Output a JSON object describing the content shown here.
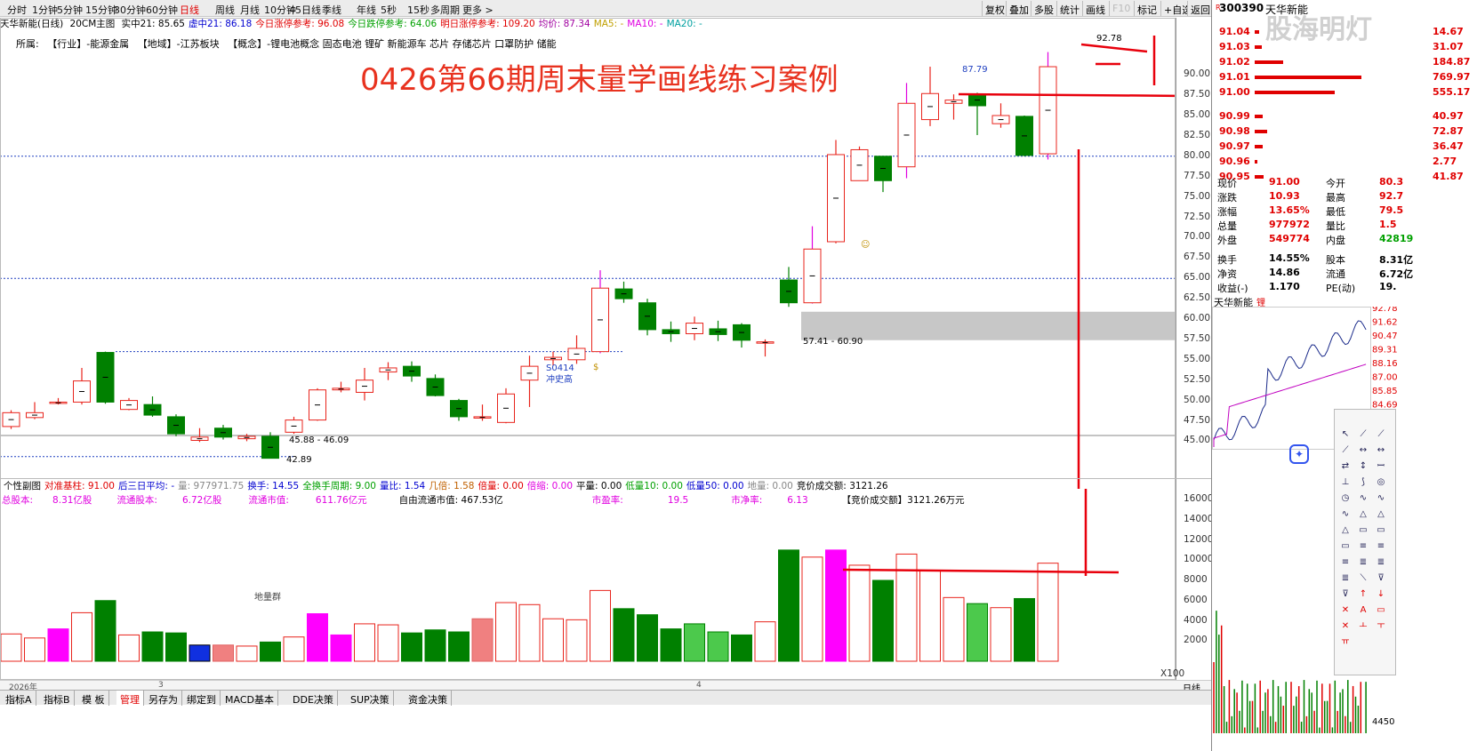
{
  "topbar": {
    "periods": [
      "分时",
      "1分钟",
      "5分钟",
      "15分钟",
      "30分钟",
      "60分钟",
      "日线",
      "周线",
      "月线",
      "10分钟",
      "45日线",
      "季线",
      "年线",
      "5秒",
      "15秒",
      "多周期",
      "更多"
    ],
    "selected_index": 6,
    "buttons": [
      "复权",
      "叠加",
      "多股",
      "统计",
      "画线",
      "F10",
      "标记",
      "+自选",
      "返回"
    ]
  },
  "title_row": {
    "name": "天华新能(日线)",
    "indicator": "20CM主图",
    "items": [
      {
        "t": "实中21: 85.65",
        "c": "#000"
      },
      {
        "t": "虚中21: 86.18",
        "c": "#0000d0"
      },
      {
        "t": "今日涨停参考: 96.08",
        "c": "#e00000"
      },
      {
        "t": "今日跌停参考: 64.06",
        "c": "#00a000"
      },
      {
        "t": "明日涨停参考: 109.20",
        "c": "#e00000"
      },
      {
        "t": "均价: 87.34",
        "c": "#a000a0"
      },
      {
        "t": "MA5: -",
        "c": "#c0a000"
      },
      {
        "t": "MA10: -",
        "c": "#e000e0"
      },
      {
        "t": "MA20: -",
        "c": "#00a0a0"
      }
    ]
  },
  "info_row": {
    "label": "所属:",
    "industry": "【行业】-能源金属",
    "region": "【地域】-江苏板块",
    "concept": "【概念】-锂电池概念 固态电池 锂矿 新能源车 芯片 存储芯片 口罩防护 储能"
  },
  "annotation": "0426第66期周末量学画线练习案例",
  "price_axis": {
    "ticks": [
      "90.00",
      "87.50",
      "85.00",
      "82.50",
      "80.00",
      "77.50",
      "75.00",
      "72.50",
      "70.00",
      "67.50",
      "65.00",
      "62.50",
      "60.00",
      "57.50",
      "55.00",
      "52.50",
      "50.00",
      "47.50",
      "45.00"
    ]
  },
  "volume_axis": {
    "ticks": [
      "16000",
      "14000",
      "12000",
      "10000",
      "8000",
      "6000",
      "4000",
      "2000"
    ],
    "unit": "X100"
  },
  "chart_labels": {
    "high_label": "92.78",
    "prev_high": "87.79",
    "zone_label": "57.41 - 60.90",
    "low_zone": "45.88 - 46.09",
    "low": "42.89",
    "mark_s": "S0414",
    "mark_s2": "冲史高",
    "volume_group": "地量群"
  },
  "sub_row1": [
    {
      "t": "个性副图",
      "c": "#000"
    },
    {
      "t": "对准基柱: 91.00",
      "c": "#e00000"
    },
    {
      "t": "后三日平均: -",
      "c": "#0000d0"
    },
    {
      "t": "量: 977971.75",
      "c": "#888"
    },
    {
      "t": "换手: 14.55",
      "c": "#0000d0"
    },
    {
      "t": "全换手周期: 9.00",
      "c": "#00a000"
    },
    {
      "t": "量比: 1.54",
      "c": "#0000d0"
    },
    {
      "t": "几倍: 1.58",
      "c": "#c06000"
    },
    {
      "t": "倍量: 0.00",
      "c": "#e00000"
    },
    {
      "t": "倍缩: 0.00",
      "c": "#e000e0"
    },
    {
      "t": "平量: 0.00",
      "c": "#000"
    },
    {
      "t": "低量10: 0.00",
      "c": "#00a000"
    },
    {
      "t": "低量50: 0.00",
      "c": "#0000d0"
    },
    {
      "t": "地量: 0.00",
      "c": "#888"
    },
    {
      "t": "竞价成交额: 3121.26",
      "c": "#000"
    }
  ],
  "sub_row2": [
    {
      "t": "总股本:",
      "c": "#e000e0"
    },
    {
      "t": "8.31亿股",
      "c": "#e000e0"
    },
    {
      "t": "流通股本:",
      "c": "#e000e0"
    },
    {
      "t": "6.72亿股",
      "c": "#e000e0"
    },
    {
      "t": "流通市值:",
      "c": "#e000e0"
    },
    {
      "t": "611.76亿元",
      "c": "#e000e0"
    },
    {
      "t": "自由流通市值: 467.53亿",
      "c": "#000"
    },
    {
      "t": "市盈率:",
      "c": "#e000e0"
    },
    {
      "t": "19.5",
      "c": "#e000e0"
    },
    {
      "t": "市净率:",
      "c": "#e000e0"
    },
    {
      "t": "6.13",
      "c": "#e000e0"
    },
    {
      "t": "【竞价成交额】3121.26万元",
      "c": "#000"
    }
  ],
  "date_row": {
    "d1": "2026年",
    "d2": "3",
    "d3": "4",
    "right": "日线"
  },
  "bottom_tabs": [
    "指标A",
    "指标B",
    "模 板",
    "管理",
    "另存为",
    "绑定到",
    "MACD基本",
    "DDE决策",
    "SUP决策",
    "资金决策"
  ],
  "bottom_tab_selected": 3,
  "right_panel": {
    "code": "300390",
    "name": "天华新能",
    "sell_levels": [
      {
        "p": "91.04",
        "v": "14.67"
      },
      {
        "p": "91.03",
        "v": "31.07"
      },
      {
        "p": "91.02",
        "v": "184.87"
      },
      {
        "p": "91.01",
        "v": "769.97"
      },
      {
        "p": "91.00",
        "v": "555.17"
      }
    ],
    "buy_levels": [
      {
        "p": "90.99",
        "v": "40.97"
      },
      {
        "p": "90.98",
        "v": "72.87"
      },
      {
        "p": "90.97",
        "v": "36.47"
      },
      {
        "p": "90.96",
        "v": "2.77"
      },
      {
        "p": "90.95",
        "v": "41.87"
      }
    ],
    "quote": [
      {
        "k": "现价",
        "v": "91.00",
        "k2": "今开",
        "v2": "80.3"
      },
      {
        "k": "涨跌",
        "v": "10.93",
        "k2": "最高",
        "v2": "92.7"
      },
      {
        "k": "涨幅",
        "v": "13.65%",
        "k2": "最低",
        "v2": "79.5"
      },
      {
        "k": "总量",
        "v": "977972",
        "k2": "量比",
        "v2": "1.5"
      },
      {
        "k": "外盘",
        "v": "549774",
        "k2": "内盘",
        "v2": "42819"
      },
      {
        "k": "换手",
        "v": "14.55%",
        "k2": "股本",
        "v2": "8.31亿"
      },
      {
        "k": "净资",
        "v": "14.86",
        "k2": "流通",
        "v2": "6.72亿"
      },
      {
        "k": "收益(-)",
        "v": "1.170",
        "k2": "PE(动)",
        "v2": "19."
      }
    ],
    "mini_label": "天华新能",
    "mini_ticks": [
      "92.78",
      "91.62",
      "90.47",
      "89.31",
      "88.16",
      "87.00",
      "85.85",
      "84.69"
    ],
    "mini_bottom": "4450",
    "watermark": "股海明灯"
  },
  "chart_data": {
    "type": "candlestick",
    "candles": [
      {
        "o": 46.8,
        "c": 48.5,
        "h": 48.8,
        "l": 46.5,
        "v": 2700
      },
      {
        "o": 47.9,
        "c": 48.5,
        "h": 49.8,
        "l": 47.7,
        "v": 2300
      },
      {
        "o": 49.8,
        "c": 49.8,
        "h": 50.3,
        "l": 49.5,
        "v": 3200
      },
      {
        "o": 49.8,
        "c": 52.4,
        "h": 54.0,
        "l": 49.5,
        "v": 4800
      },
      {
        "o": 55.9,
        "c": 49.8,
        "h": 56.0,
        "l": 49.6,
        "v": 6000
      },
      {
        "o": 48.9,
        "c": 50.0,
        "h": 50.3,
        "l": 48.8,
        "v": 2600
      },
      {
        "o": 49.5,
        "c": 48.2,
        "h": 50.5,
        "l": 48.0,
        "v": 2900
      },
      {
        "o": 48.0,
        "c": 45.9,
        "h": 48.3,
        "l": 45.6,
        "v": 2800
      },
      {
        "o": 45.1,
        "c": 45.5,
        "h": 46.6,
        "l": 44.9,
        "v": 1600
      },
      {
        "o": 46.6,
        "c": 45.5,
        "h": 47.0,
        "l": 45.2,
        "v": 1600
      },
      {
        "o": 45.3,
        "c": 45.6,
        "h": 45.9,
        "l": 45.0,
        "v": 1500
      },
      {
        "o": 45.6,
        "c": 42.9,
        "h": 46.1,
        "l": 42.9,
        "v": 1900
      },
      {
        "o": 46.1,
        "c": 47.6,
        "h": 48.0,
        "l": 45.9,
        "v": 2400
      },
      {
        "o": 47.6,
        "c": 51.3,
        "h": 51.5,
        "l": 47.5,
        "v": 4700
      },
      {
        "o": 51.3,
        "c": 51.5,
        "h": 52.3,
        "l": 51.0,
        "v": 2600
      },
      {
        "o": 51.0,
        "c": 52.5,
        "h": 54.0,
        "l": 50.0,
        "v": 3700
      },
      {
        "o": 53.5,
        "c": 54.0,
        "h": 54.7,
        "l": 52.5,
        "v": 3600
      },
      {
        "o": 54.2,
        "c": 53.0,
        "h": 54.8,
        "l": 52.3,
        "v": 2800
      },
      {
        "o": 52.7,
        "c": 50.6,
        "h": 53.2,
        "l": 50.5,
        "v": 3100
      },
      {
        "o": 50.0,
        "c": 48.0,
        "h": 50.2,
        "l": 47.5,
        "v": 2900
      },
      {
        "o": 47.9,
        "c": 48.0,
        "h": 49.5,
        "l": 47.5,
        "v": 4200
      },
      {
        "o": 47.3,
        "c": 50.8,
        "h": 51.5,
        "l": 47.2,
        "v": 5800
      },
      {
        "o": 52.5,
        "c": 54.2,
        "h": 55.5,
        "l": 49.2,
        "v": 5600
      },
      {
        "o": 55.0,
        "c": 55.3,
        "h": 56.0,
        "l": 54.3,
        "v": 4200
      },
      {
        "o": 55.0,
        "c": 56.4,
        "h": 58.0,
        "l": 54.5,
        "v": 4100
      },
      {
        "o": 56.0,
        "c": 63.8,
        "h": 66.0,
        "l": 55.8,
        "v": 7000
      },
      {
        "o": 63.7,
        "c": 62.5,
        "h": 64.6,
        "l": 62.0,
        "v": 5200
      },
      {
        "o": 62.0,
        "c": 58.7,
        "h": 62.5,
        "l": 58.0,
        "v": 4600
      },
      {
        "o": 58.7,
        "c": 58.2,
        "h": 59.7,
        "l": 57.2,
        "v": 3200
      },
      {
        "o": 58.2,
        "c": 59.5,
        "h": 60.3,
        "l": 57.4,
        "v": 3700
      },
      {
        "o": 58.8,
        "c": 58.1,
        "h": 59.8,
        "l": 57.3,
        "v": 2900
      },
      {
        "o": 59.3,
        "c": 57.4,
        "h": 59.5,
        "l": 56.5,
        "v": 2600
      },
      {
        "o": 57.1,
        "c": 57.2,
        "h": 57.5,
        "l": 55.4,
        "v": 3900
      },
      {
        "o": 64.8,
        "c": 62.0,
        "h": 66.4,
        "l": 61.5,
        "v": 11000
      },
      {
        "o": 62.0,
        "c": 68.6,
        "h": 71.4,
        "l": 61.9,
        "v": 10300
      },
      {
        "o": 69.5,
        "c": 80.2,
        "h": 82.0,
        "l": 69.3,
        "v": 11000
      },
      {
        "o": 77.0,
        "c": 80.8,
        "h": 81.2,
        "l": 77.0,
        "v": 9500
      },
      {
        "o": 80.0,
        "c": 77.0,
        "h": 80.0,
        "l": 75.6,
        "v": 8000
      },
      {
        "o": 78.7,
        "c": 86.5,
        "h": 89.0,
        "l": 77.3,
        "v": 10600
      },
      {
        "o": 84.5,
        "c": 87.7,
        "h": 91.0,
        "l": 83.7,
        "v": 9000
      },
      {
        "o": 86.5,
        "c": 86.9,
        "h": 87.6,
        "l": 84.5,
        "v": 6300
      },
      {
        "o": 87.6,
        "c": 86.2,
        "h": 87.8,
        "l": 82.6,
        "v": 5700
      },
      {
        "o": 84.0,
        "c": 85.0,
        "h": 86.5,
        "l": 83.5,
        "v": 5300
      },
      {
        "o": 84.9,
        "c": 80.1,
        "h": 85.0,
        "l": 80.0,
        "v": 6200
      },
      {
        "o": 80.3,
        "c": 91.0,
        "h": 92.8,
        "l": 79.6,
        "v": 9700
      }
    ]
  },
  "colors": {
    "up": "#e8241c",
    "down": "#008000",
    "vol_special": "#ff00ff",
    "annot": "#e8321f"
  }
}
